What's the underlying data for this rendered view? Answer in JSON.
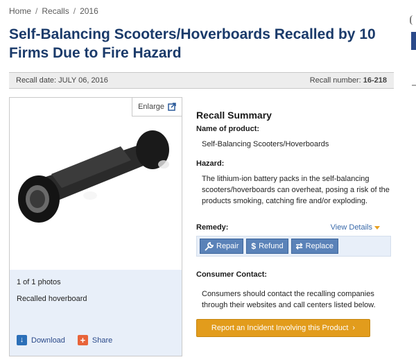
{
  "breadcrumb": {
    "home": "Home",
    "recalls": "Recalls",
    "year": "2016",
    "separator": "/"
  },
  "title": "Self-Balancing Scooters/Hoverboards Recalled by 10 Firms Due to Fire Hazard",
  "info_bar": {
    "recall_date_label": "Recall date:",
    "recall_date": "JULY 06, 2016",
    "recall_number_label": "Recall number:",
    "recall_number": "16-218"
  },
  "photo": {
    "enlarge_label": "Enlarge",
    "count": "1 of 1 photos",
    "caption": "Recalled hoverboard",
    "download_label": "Download",
    "share_label": "Share"
  },
  "summary": {
    "heading": "Recall Summary",
    "name_label": "Name of product:",
    "name_value": "Self-Balancing Scooters/Hoverboards",
    "hazard_label": "Hazard:",
    "hazard_value": "The lithium-ion battery packs in the self-balancing scooters/hoverboards can overheat, posing a risk of the products smoking, catching fire and/or exploding.",
    "remedy_label": "Remedy:",
    "view_details": "View Details",
    "remedies": [
      "Repair",
      "Refund",
      "Replace"
    ],
    "contact_label": "Consumer Contact:",
    "contact_value": "Consumers should contact the recalling companies through their websites and call centers listed below.",
    "incident_button": "Report an Incident Involving this Product"
  },
  "colors": {
    "title": "#1a3a6a",
    "accent_orange": "#e29c1c",
    "remedy_blue": "#5a82b8",
    "panel_blue": "#e8eff9"
  },
  "icons": {
    "enlarge": "external-link-icon",
    "download": "download-icon",
    "share": "plus-icon",
    "repair": "wrench-icon",
    "refund": "dollar-icon",
    "replace": "swap-icon",
    "incident": "chevron-right-icon"
  }
}
